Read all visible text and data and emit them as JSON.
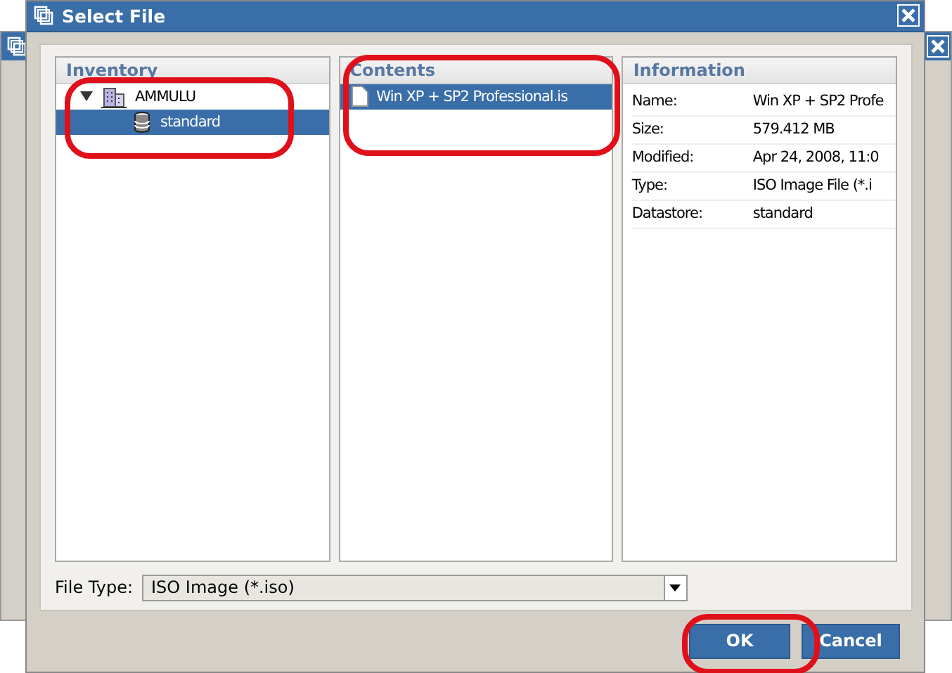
{
  "window": {
    "title": "Select File"
  },
  "inventory": {
    "title": "Inventory",
    "tree": [
      {
        "label": "AMMULU",
        "kind": "host",
        "expanded": true,
        "selected": false,
        "children": [
          {
            "label": "standard",
            "kind": "datastore",
            "selected": true
          }
        ]
      }
    ]
  },
  "contents": {
    "title": "Contents",
    "files": [
      {
        "name": "Win XP + SP2 Professional.is",
        "selected": true
      }
    ]
  },
  "information": {
    "title": "Information",
    "fields": [
      {
        "label": "Name:",
        "value": "Win XP + SP2 Profe"
      },
      {
        "label": "Size:",
        "value": "579.412 MB"
      },
      {
        "label": "Modified:",
        "value": "Apr 24, 2008, 11:0"
      },
      {
        "label": "Type:",
        "value": "ISO Image File (*.i"
      },
      {
        "label": "Datastore:",
        "value": "standard"
      }
    ]
  },
  "file_type": {
    "label": "File Type:",
    "value": "ISO Image (*.iso)"
  },
  "buttons": [
    {
      "label": "OK"
    },
    {
      "label": "Cancel"
    }
  ]
}
